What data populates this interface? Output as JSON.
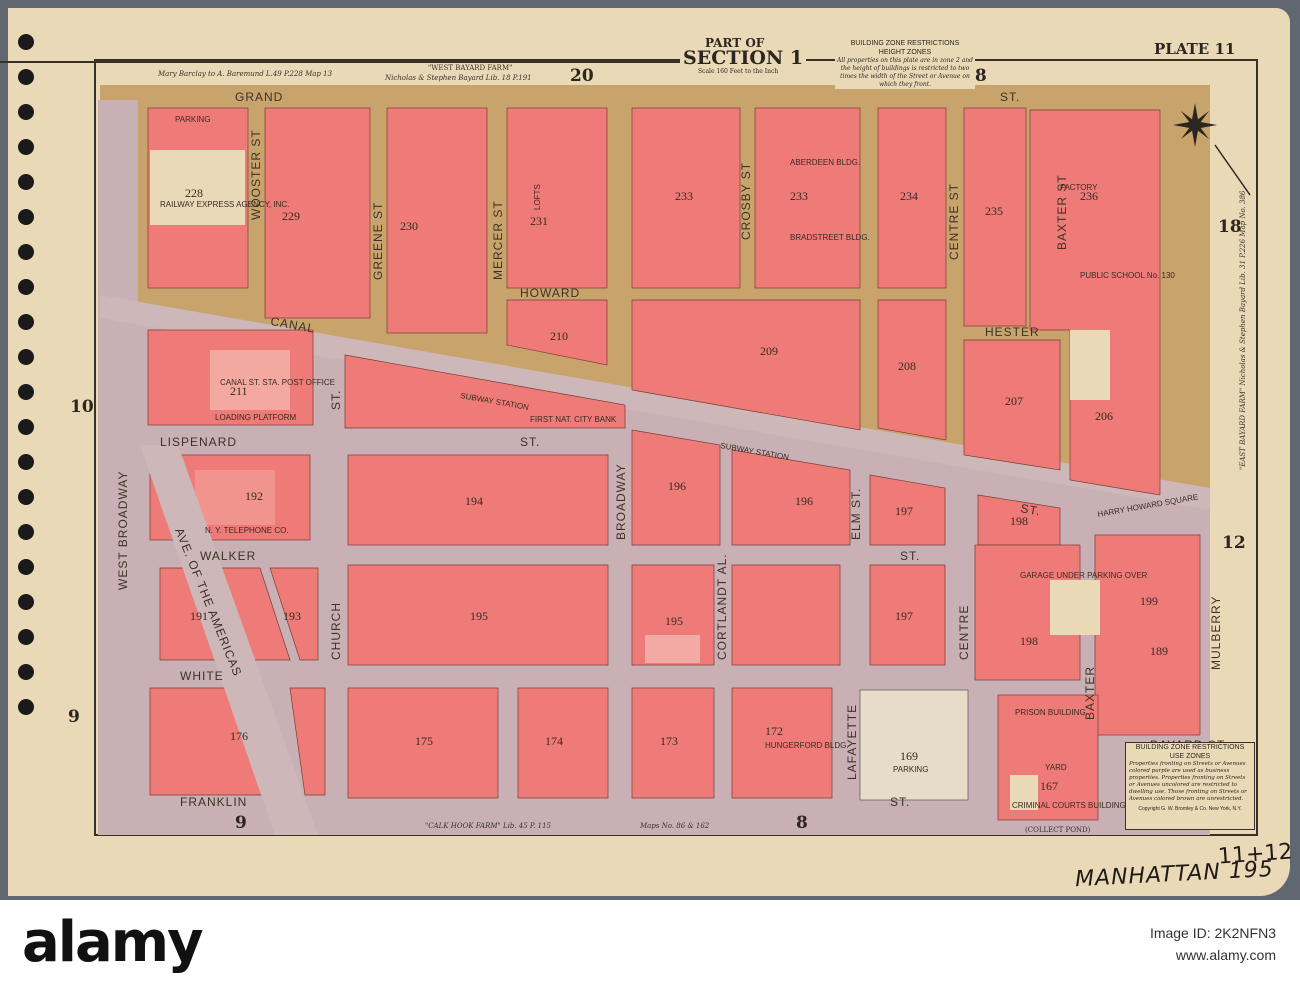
{
  "header": {
    "part_of": "PART OF",
    "section": "SECTION 1",
    "scale": "Scale 160 Feet to the Inch",
    "plate": "PLATE 11",
    "height_zones_title": "BUILDING ZONE RESTRICTIONS",
    "height_zones_subtitle": "HEIGHT ZONES",
    "height_zones_text": "All properties on this plate are in zone 2 and the height of buildings is restricted to two times the width of the Street or Avenue on which they front."
  },
  "use_zones": {
    "title": "BUILDING ZONE RESTRICTIONS",
    "subtitle": "USE ZONES",
    "text": "Properties fronting on Streets or Avenues colored purple are used as business properties. Properties fronting on Streets or Avenues uncolored are restricted to dwelling use. Those fronting on Streets or Avenues colored brown are unrestricted.",
    "copyright": "Copyright G. W. Bromley & Co. New York, N.Y."
  },
  "farm_notes": {
    "top_left": "Mary Barclay to A. Baremund L.49 P.228 Map 13",
    "top_mid_title": "\"WEST BAYARD FARM\"",
    "top_mid": "Nicholas & Stephen Bayard Lib. 18 P.191",
    "right": "\"EAST BAYARD FARM\" Nicholas & Stephen Bayard Lib. 31 P.226 Map No. 386",
    "bottom_left": "\"CALK HOOK FARM\" Lib. 45 P. 115",
    "bottom_mid": "Maps No. 86 & 162",
    "bottom_right": "(COLLECT POND)"
  },
  "adjacent_plates": [
    "20",
    "18",
    "18",
    "10",
    "12",
    "9",
    "9",
    "8"
  ],
  "streets": {
    "grand": "GRAND",
    "grand_st": "ST.",
    "canal": "CANAL",
    "howard": "HOWARD",
    "hester": "HESTER",
    "lispenard": "LISPENARD",
    "lispenard_st": "ST.",
    "walker": "WALKER",
    "walker_st": "ST.",
    "white": "WHITE",
    "franklin": "FRANKLIN",
    "franklin_st": "ST.",
    "bayard": "BAYARD ST.",
    "west_broadway": "WEST BROADWAY",
    "wooster": "WOOSTER ST",
    "greene": "GREENE ST",
    "mercer": "MERCER ST",
    "broadway": "BROADWAY",
    "crosby": "CROSBY ST",
    "centre_upper": "CENTRE ST",
    "baxter_upper": "BAXTER ST",
    "church": "CHURCH",
    "church_st": "ST.",
    "ave_americas": "AVE. OF THE AMERICAS",
    "cortlandt": "CORTLANDT AL.",
    "elm": "ELM ST.",
    "lafayette": "LAFAYETTE",
    "centre": "CENTRE",
    "baxter": "BAXTER",
    "mulberry": "MULBERRY",
    "canal_st": "ST."
  },
  "places": {
    "railway_express": "RAILWAY EXPRESS AGENCY, INC.",
    "parking": "PARKING",
    "canal_post_office": "CANAL ST. STA. POST OFFICE",
    "loading_platform": "LOADING PLATFORM",
    "ny_telephone": "N. Y. TELEPHONE CO.",
    "subway_station_1": "SUBWAY STATION",
    "subway_station_2": "SUBWAY STATION",
    "first_nat_city_bank": "FIRST NAT. CITY BANK",
    "aberdeen": "ABERDEEN BLDG.",
    "bradstreet": "BRADSTREET BLDG.",
    "public_school": "PUBLIC SCHOOL No. 130",
    "factory": "FACTORY",
    "harry_howard_square": "HARRY HOWARD SQUARE",
    "garage_under_parking": "GARAGE UNDER PARKING OVER",
    "hungerford": "HUNGERFORD BLDG.",
    "prison": "PRISON BUILDING",
    "yard": "YARD",
    "criminal_courts": "CRIMINAL COURTS BUILDING",
    "parking_169": "PARKING",
    "lofts": "LOFTS"
  },
  "blocks": [
    "228",
    "229",
    "230",
    "231",
    "233",
    "233",
    "234",
    "235",
    "236",
    "211",
    "210",
    "209",
    "208",
    "207",
    "206",
    "192",
    "194",
    "196",
    "196",
    "197",
    "198",
    "199",
    "191",
    "193",
    "195",
    "195",
    "197",
    "198",
    "189",
    "176",
    "175",
    "174",
    "173",
    "172",
    "169",
    "167"
  ],
  "annotations": {
    "handwritten_plates": "11+12",
    "handwritten_title": "MANHATTAN 195"
  },
  "watermark": {
    "logo": "alamy",
    "image_id": "Image ID: 2K2NFN3",
    "site": "www.alamy.com"
  },
  "colors": {
    "paper": "#ead9b6",
    "block_pink": "#ee7b78",
    "street_brown": "#c9a36c",
    "street_purple": "#c8b0b4"
  }
}
